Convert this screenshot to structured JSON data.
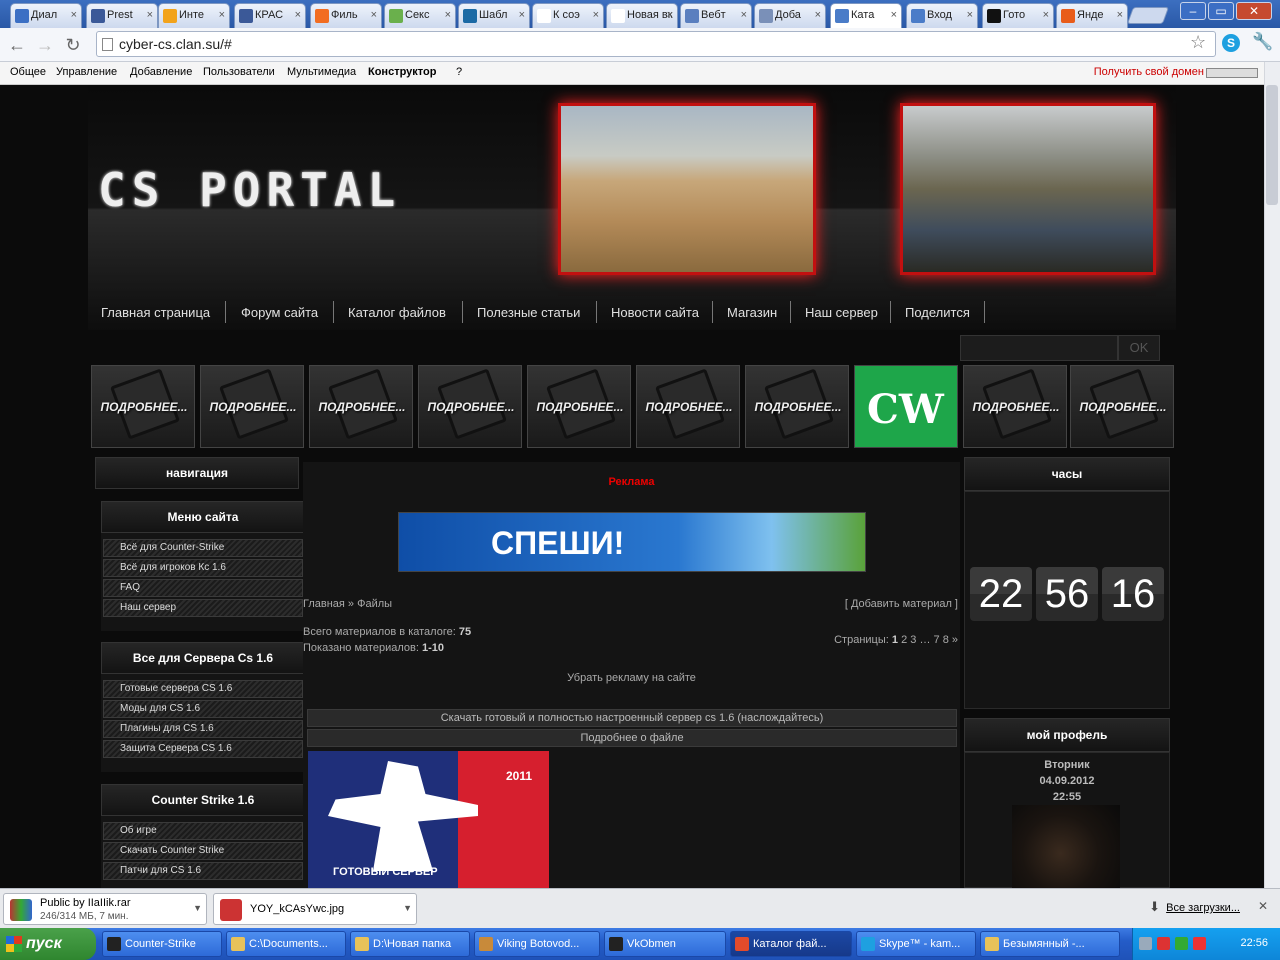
{
  "browser": {
    "tabs": [
      {
        "label": "Диал",
        "color": "#3b6fc4"
      },
      {
        "label": "Prest",
        "color": "#3b5998"
      },
      {
        "label": "Инте",
        "color": "#f2a31b"
      },
      {
        "label": "КРАС",
        "color": "#3b5998"
      },
      {
        "label": "Филь",
        "color": "#f26d21"
      },
      {
        "label": "Секс",
        "color": "#6ab04c"
      },
      {
        "label": "Шабл",
        "color": "#1b6aa5"
      },
      {
        "label": "К соэ",
        "color": "#ffffff"
      },
      {
        "label": "Новая вк",
        "color": "#ffffff"
      },
      {
        "label": "Вебт",
        "color": "#5a7fbf"
      },
      {
        "label": "Доба",
        "color": "#7a90b8"
      },
      {
        "label": "Ката",
        "color": "#4a7cc8"
      },
      {
        "label": "Вход",
        "color": "#4a7cc8"
      },
      {
        "label": "Гото",
        "color": "#111111"
      },
      {
        "label": "Янде",
        "color": "#e85c1a"
      }
    ],
    "url": "cyber-cs.clan.su/#"
  },
  "ucoz": {
    "menu": [
      "Общее",
      "Управление",
      "Добавление",
      "Пользователи",
      "Мультимедиа",
      "Конструктор",
      "?"
    ],
    "domain_link": "Получить свой домен"
  },
  "site": {
    "logo": "CS PORTAL",
    "nav": [
      "Главная страница",
      "Форум сайта",
      "Каталог файлов",
      "Полезные статьи",
      "Новости сайта",
      "Магазин",
      "Наш сервер",
      "Поделится"
    ],
    "search_button": "OK",
    "thumb_label": "ПОДРОБНЕЕ...",
    "cw_label": "CW",
    "left": {
      "nav_header": "навигация",
      "boxes": [
        {
          "title": "Меню сайта",
          "items": [
            "Всё для Counter-Strike",
            "Всё для игроков Кс 1.6",
            "FAQ",
            "Наш сервер"
          ]
        },
        {
          "title": "Все для Сервера Cs 1.6",
          "items": [
            "Готовые сервера CS 1.6",
            "Моды для CS 1.6",
            "Плагины для CS 1.6",
            "Защита Сервера CS 1.6"
          ]
        },
        {
          "title": "Counter Strike 1.6",
          "items": [
            "Об игре",
            "Скачать Counter Strike",
            "Патчи для CS 1.6"
          ]
        }
      ]
    },
    "center": {
      "ad_title": "Реклама",
      "banner_text": "СПЕШИ!",
      "breadcrumb": "Главная » Файлы",
      "add_material": "[ Добавить материал ]",
      "total_label": "Всего материалов в каталоге:",
      "total_value": "75",
      "shown_label": "Показано материалов:",
      "shown_value": "1-10",
      "pages_label": "Страницы:",
      "pages": [
        "1",
        "2",
        "3",
        "…",
        "7",
        "8",
        "»"
      ],
      "remove_ads": "Убрать рекламу на сайте",
      "file_title": "Скачать готовый и полностью настроенный сервер cs 1.6 (наслождайтесь)",
      "file_more": "Подробнее о файле",
      "poster_year": "2011",
      "poster_caption": "ГОТОВЫЙ СЕРВЕР"
    },
    "right": {
      "clock_header": "часы",
      "clock": [
        "22",
        "56",
        "16"
      ],
      "profile_header": "мой профель",
      "day": "Вторник",
      "date": "04.09.2012",
      "time": "22:55"
    }
  },
  "downloads": [
    {
      "name": "Public by IIaIIik.rar",
      "status": "246/314 МБ, 7 мин."
    },
    {
      "name": "YOY_kCAsYwc.jpg",
      "status": ""
    }
  ],
  "all_downloads": "Все загрузки...",
  "taskbar": {
    "start": "пуск",
    "items": [
      {
        "label": "Counter-Strike",
        "color": "#222222"
      },
      {
        "label": "C:\\Documents...",
        "color": "#e8c25a"
      },
      {
        "label": "D:\\Новая папка",
        "color": "#e8c25a"
      },
      {
        "label": "Viking Botovod...",
        "color": "#c88a3a"
      },
      {
        "label": "VkObmen",
        "color": "#222222"
      },
      {
        "label": "Каталог фай...",
        "color": "#e34b2b"
      },
      {
        "label": "Skype™ - kam...",
        "color": "#1ea0e0"
      },
      {
        "label": "Безымянный -...",
        "color": "#e8c25a"
      }
    ],
    "clock": "22:56"
  }
}
